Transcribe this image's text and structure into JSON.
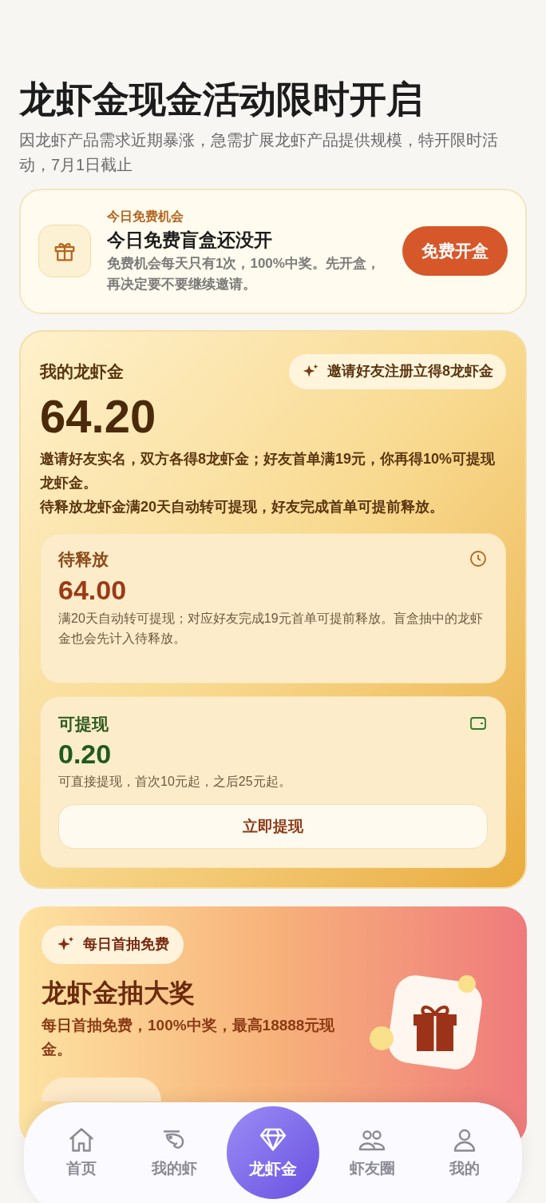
{
  "header": {
    "title": "龙虾金现金活动限时开启",
    "subtitle": "因龙虾产品需求近期暴涨，急需扩展龙虾产品提供规模，特开限时活动，7月1日截止"
  },
  "free_box": {
    "eyebrow": "今日免费机会",
    "title": "今日免费盲盒还没开",
    "description": "免费机会每天只有1次，100%中奖。先开盒，再决定要不要继续邀请。",
    "button": "免费开盒"
  },
  "balance": {
    "label": "我的龙虾金",
    "invite_chip": "邀请好友注册立得8龙虾金",
    "amount": "64.20",
    "notes": [
      "邀请好友实名，双方各得8龙虾金；好友首单满19元，你再得10%可提现龙虾金。",
      "待释放龙虾金满20天自动转可提现，好友完成首单可提前释放。"
    ],
    "pending": {
      "label": "待释放",
      "amount": "64.00",
      "description": "满20天自动转可提现；对应好友完成19元首单可提前释放。盲盒抽中的龙虾金也会先计入待释放。"
    },
    "withdrawable": {
      "label": "可提现",
      "amount": "0.20",
      "description": "可直接提现，首次10元起，之后25元起。",
      "button": "立即提现"
    }
  },
  "lottery": {
    "chip": "每日首抽免费",
    "title": "龙虾金抽大奖",
    "description": "每日首抽免费，100%中奖，最高18888元现金。"
  },
  "nav": [
    {
      "kind": "home",
      "label": "首页",
      "selected": false
    },
    {
      "kind": "shrimp",
      "label": "我的虾",
      "selected": false
    },
    {
      "kind": "diamond",
      "label": "龙虾金",
      "selected": true
    },
    {
      "kind": "friends",
      "label": "虾友圈",
      "selected": false
    },
    {
      "kind": "profile",
      "label": "我的",
      "selected": false
    }
  ]
}
